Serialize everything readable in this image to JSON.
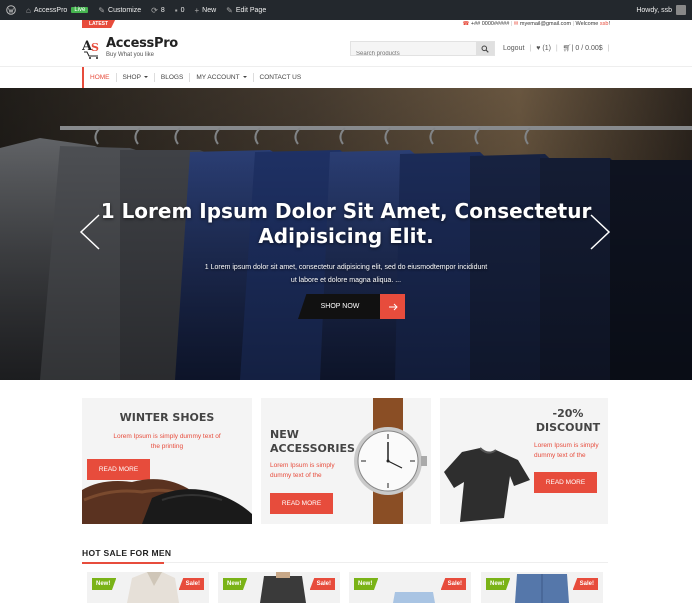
{
  "adminbar": {
    "site_name": "AccessPro",
    "live_badge": "Live",
    "customize": "Customize",
    "updates_count": "8",
    "comments_count": "0",
    "new_label": "New",
    "edit_page": "Edit Page",
    "howdy": "Howdy, ssb"
  },
  "topstrip": {
    "latest": "LATEST",
    "phone": "+## 0000#####",
    "email": "myemail@gmail.com",
    "welcome_prefix": "Welcome",
    "welcome_user": "ssb",
    "welcome_suffix": "!"
  },
  "header": {
    "logo_title": "AccessPro",
    "logo_tagline": "Buy What you like",
    "search_placeholder": "Search products",
    "logout": "Logout",
    "wishlist": "(1)",
    "cart": "| 0 / 0.00$"
  },
  "nav": {
    "items": [
      {
        "label": "HOME"
      },
      {
        "label": "SHOP"
      },
      {
        "label": "BLOGS"
      },
      {
        "label": "MY ACCOUNT"
      },
      {
        "label": "CONTACT US"
      }
    ]
  },
  "hero": {
    "title_line1": "1 Lorem Ipsum Dolor Sit Amet, Consectetur",
    "title_line2": "Adipisicing Elit.",
    "sub_line1": "1 Lorem ipsum dolor sit amet, consectetur adipisicing elit, sed do eiusmodtempor incididunt",
    "sub_line2": "ut labore et dolore magna aliqua. ...",
    "button": "SHOP NOW"
  },
  "promos": [
    {
      "title": "WINTER SHOES",
      "text1": "Lorem Ipsum is simply dummy text of",
      "text2": "the printing",
      "button": "READ MORE"
    },
    {
      "title1": "NEW",
      "title2": "ACCESSORIES",
      "text1": "Lorem Ipsum is simply",
      "text2": "dummy text of the",
      "button": "READ MORE"
    },
    {
      "title1": "-20%",
      "title2": "DISCOUNT",
      "text1": "Lorem Ipsum is simply",
      "text2": "dummy text of the",
      "button": "READ MORE"
    }
  ],
  "hot_sale": {
    "title": "HOT SALE FOR MEN",
    "badge_new": "New!",
    "badge_sale": "Sale!"
  },
  "colors": {
    "accent": "#e74c3c",
    "new_badge": "#7ab317",
    "adminbar": "#23282d"
  }
}
